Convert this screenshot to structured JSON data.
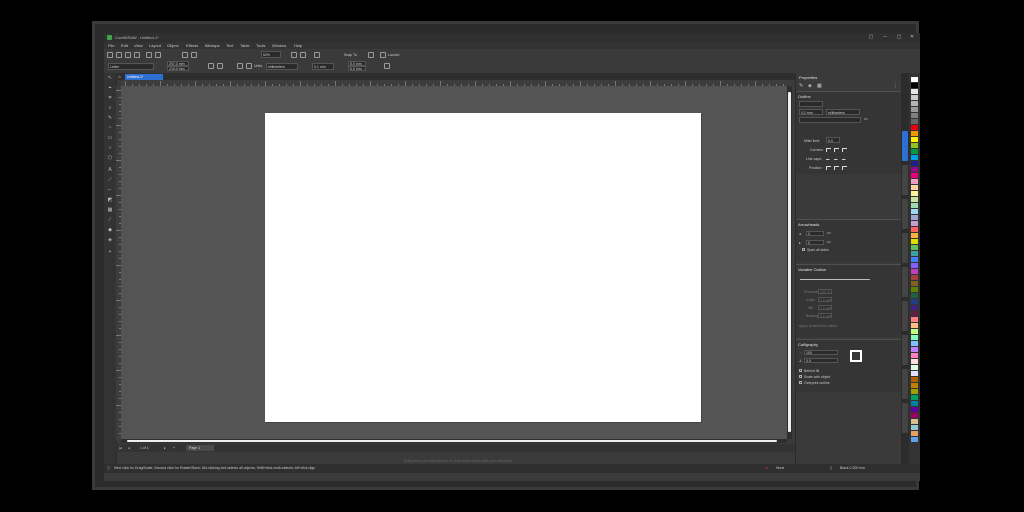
{
  "window": {
    "title": "CorelDRAW - Untitled-1*",
    "controls": [
      "▢",
      "─",
      "▢",
      "✕"
    ]
  },
  "menu": [
    "File",
    "Edit",
    "View",
    "Layout",
    "Object",
    "Effects",
    "Bitmaps",
    "Text",
    "Table",
    "Tools",
    "Window",
    "Help"
  ],
  "standard_toolbar": {
    "zoom_value": "52%",
    "snap_to_label": "Snap To",
    "launch_label": "Launch"
  },
  "property_bar": {
    "page_size": "Letter",
    "width": "297.0 mm",
    "height": "210.0 mm",
    "units_label": "Units:",
    "units_value": "millimeters",
    "nudge": "0.1 mm",
    "dup_x": "5.0 mm",
    "dup_y": "5.0 mm"
  },
  "document_tab": "Untitled-1*",
  "page_nav": {
    "position": "1 of 1",
    "page_tab": "Page 1"
  },
  "canvas_hint": "Drag colors (or objects) here to store these colors with your document",
  "status": {
    "hint": "Next click for Drag/Scale; Second click for Rotate/Skew; Dbl-clicking tool selects all objects; Shift+click multi-selects; Alt+click digs",
    "fill_label": "None",
    "outline_label": "Black  0.200 mm"
  },
  "properties_docker": {
    "title": "Properties",
    "outline": {
      "header": "Outline",
      "width": "0.2 mm",
      "units": "millimeters",
      "miter_label": "Miter limit:",
      "miter_value": "5.0",
      "corners_label": "Corners:",
      "line_caps_label": "Line caps:",
      "position_label": "Position:"
    },
    "arrowheads": {
      "header": "Arrowheads",
      "value1": "0",
      "value2": "0",
      "span_all_label": "Span all sides"
    },
    "variable": {
      "header": "Variable Outline",
      "fields": [
        "Pressure",
        "Angle",
        "Nib",
        "Bearing",
        "Rotation"
      ],
      "values": [
        "100 %",
        "0.0 mm",
        "0.0 mm",
        "0.0 mm"
      ],
      "apply_label": "Apply to selected outline"
    },
    "calligraphy": {
      "header": "Calligraphy",
      "stretch": "100",
      "angle": "0.0",
      "behind_fill": "Behind fill",
      "scale_with_object": "Scale with object",
      "overprint": "Overprint outline"
    }
  },
  "colors": {
    "accent": "#2d6fd2",
    "app_bg": "#3b3b3b",
    "canvas_bg": "#545454",
    "page": "#ffffff",
    "palette": [
      "#ffffff",
      "#000000",
      "#e6e6e6",
      "#cccccc",
      "#b3b3b3",
      "#999999",
      "#808080",
      "#666666",
      "#e60012",
      "#f39800",
      "#fff100",
      "#8fc31f",
      "#009944",
      "#00a0e9",
      "#1d2088",
      "#920783",
      "#e4007f",
      "#f0a0c0",
      "#ffd0a0",
      "#fff5a0",
      "#c8e6a0",
      "#a0d8b0",
      "#a0d8f0",
      "#a0a8d8",
      "#c8a0d0",
      "#ff6060",
      "#ffb040",
      "#e0e000",
      "#60c060",
      "#40a0a0",
      "#4080ff",
      "#8060ff",
      "#c040c0",
      "#a04040",
      "#806020",
      "#608000",
      "#206040",
      "#204080",
      "#402080",
      "#602040",
      "#ff8080",
      "#ffc080",
      "#c0ff80",
      "#80ffc0",
      "#80c0ff",
      "#c080ff",
      "#ff80c0",
      "#ffe0e0",
      "#e0ffe0",
      "#e0e0ff",
      "#b06000",
      "#c08000",
      "#a0a000",
      "#00a060",
      "#0080a0",
      "#6000a0",
      "#a00060",
      "#d8c090",
      "#90c8d8",
      "#e8a060",
      "#60a0e8"
    ]
  },
  "icons": [
    "corel-logo-icon",
    "new-icon",
    "open-icon",
    "save-icon",
    "print-icon",
    "undo-icon",
    "redo-icon",
    "import-icon",
    "export-icon",
    "zoom-icon",
    "snap-icon",
    "settings-icon",
    "launch-icon",
    "home-icon",
    "pick-tool-icon",
    "shape-tool-icon",
    "crop-tool-icon",
    "zoom-tool-icon",
    "freehand-tool-icon",
    "artistic-media-icon",
    "rectangle-tool-icon",
    "ellipse-tool-icon",
    "polygon-tool-icon",
    "text-tool-icon",
    "parallel-dimension-icon",
    "connector-icon",
    "drop-shadow-icon",
    "transparency-icon",
    "eyedropper-icon",
    "interactive-fill-icon",
    "smart-fill-icon",
    "add-tool-icon"
  ]
}
